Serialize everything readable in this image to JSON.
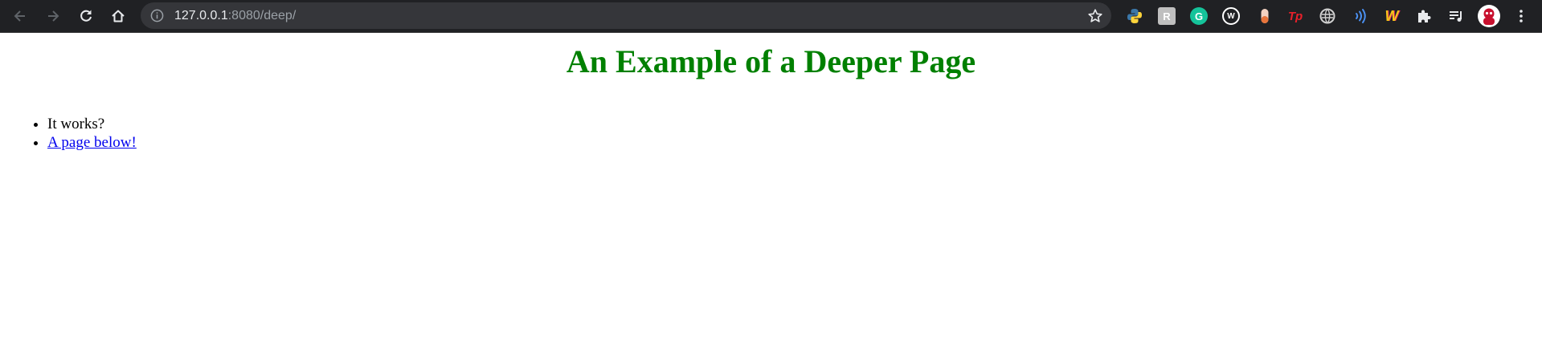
{
  "browser": {
    "url_host": "127.0.0.1",
    "url_rest": ":8080/deep/",
    "icons": {
      "back": "arrow-left-icon",
      "forward": "arrow-right-icon",
      "reload": "reload-icon",
      "home": "home-icon",
      "site_info": "info-icon",
      "bookmark": "star-icon"
    },
    "extensions": [
      "python-icon",
      "r-icon",
      "grammarly-icon",
      "w-circle-icon",
      "pill-icon",
      "tp-icon",
      "globe-icon",
      "wifi-waves-icon",
      "w-logo-icon",
      "puzzle-icon",
      "media-queue-icon",
      "profile-avatar",
      "kebab-menu-icon"
    ],
    "colors": {
      "toolbar_bg": "#202124",
      "omnibox_bg": "#35363a"
    }
  },
  "page": {
    "title": "An Example of a Deeper Page",
    "items": [
      {
        "text": "It works?"
      },
      {
        "link_text": "A page below!"
      }
    ],
    "colors": {
      "title": "#008000",
      "link": "#0000ee"
    }
  }
}
